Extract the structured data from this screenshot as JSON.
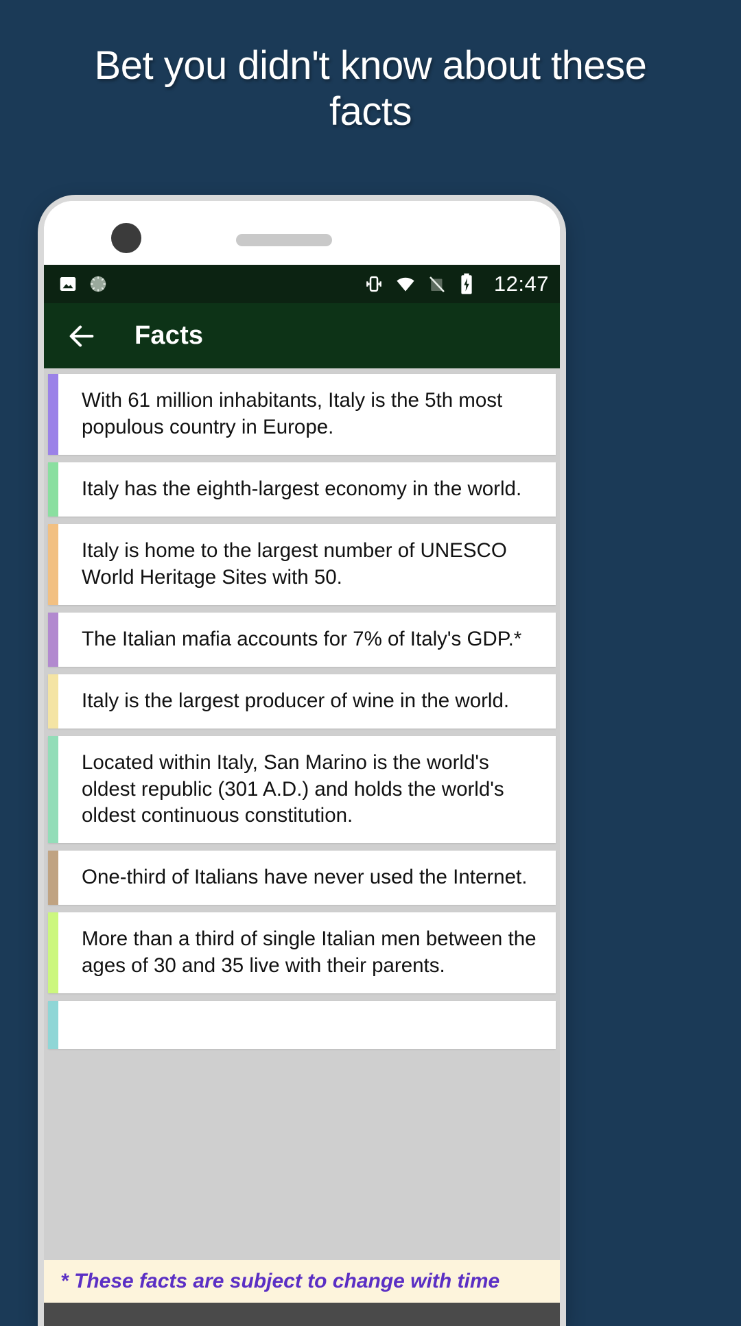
{
  "promo": {
    "headline": "Bet you didn't know about these facts"
  },
  "status_bar": {
    "icons_left": [
      "image-icon",
      "sync-spinner-icon"
    ],
    "icons_right": [
      "vibrate-icon",
      "wifi-icon",
      "signal-off-icon",
      "battery-charging-icon"
    ],
    "time": "12:47"
  },
  "app_bar": {
    "back_icon": "back-arrow-icon",
    "title": "Facts"
  },
  "facts": [
    {
      "text": "With 61 million inhabitants, Italy is the 5th most populous country in Europe.",
      "accent": "#9b82e8"
    },
    {
      "text": "Italy has the eighth-largest economy in the world.",
      "accent": "#8adfa0"
    },
    {
      "text": "Italy is home to the largest number of UNESCO World Heritage Sites with 50.",
      "accent": "#f2c082"
    },
    {
      "text": "The Italian mafia accounts for 7% of Italy's GDP.*",
      "accent": "#b289cf"
    },
    {
      "text": "Italy is the largest producer of wine in the world.",
      "accent": "#f4e4a4"
    },
    {
      "text": "Located within Italy, San Marino is the world's oldest republic (301 A.D.) and holds the world's oldest continuous constitution.",
      "accent": "#93ddb8"
    },
    {
      "text": "One-third of Italians have never used the Internet.",
      "accent": "#c0a382"
    },
    {
      "text": "More than a third of single Italian men between the ages of 30 and 35 live with their parents.",
      "accent": "#ccf77e"
    },
    {
      "text": "",
      "accent": "#8fd6d6"
    }
  ],
  "footer": {
    "note": "* These facts are subject to change with time"
  },
  "colors": {
    "promo_background": "#1b3a57",
    "status_bar_bg": "#0c2312",
    "app_bar_bg": "#0d3317",
    "list_bg": "#cfcfcf",
    "card_bg": "#ffffff",
    "footer_bg": "#fdf4dc",
    "footer_text": "#5b2fc4"
  }
}
